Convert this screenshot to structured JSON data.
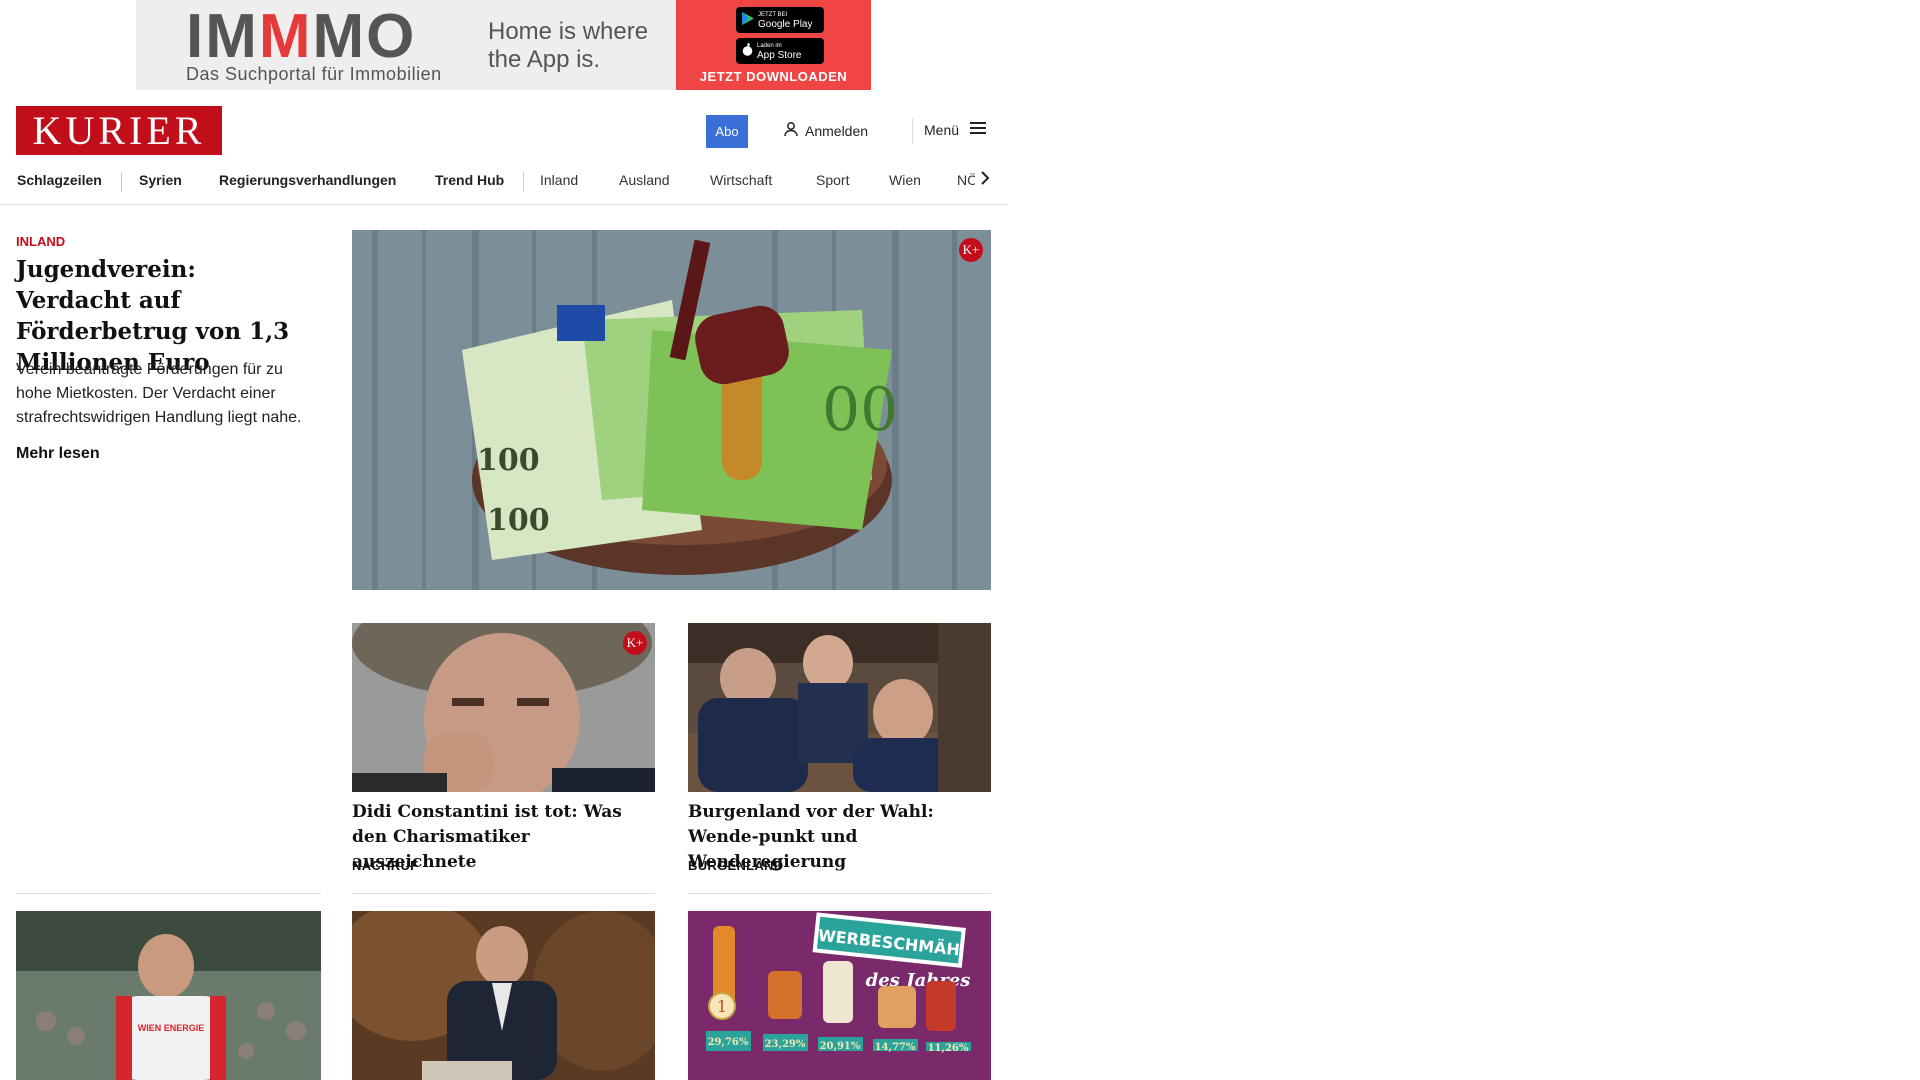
{
  "ad": {
    "brand_a": "IM",
    "brand_b": "M",
    "brand_c": "MO",
    "subtitle": "Das Suchportal für Immobilien",
    "slogan_line1": "Home is where",
    "slogan_line2": "the App is.",
    "google_play_small": "JETZT BEI",
    "google_play": "Google Play",
    "app_store_small": "Laden im",
    "app_store": "App Store",
    "cta": "JETZT DOWNLOADEN",
    "accent_color": "#f04545"
  },
  "header": {
    "logo": "KURIER",
    "abo": "Abo",
    "login": "Anmelden",
    "menu": "Menü",
    "brand_color": "#c20e1a",
    "abo_color": "#3a6fd8"
  },
  "nav": {
    "items": [
      "Schlagzeilen",
      "Syrien",
      "Regierungsverhandlungen",
      "Trend Hub",
      "Inland",
      "Ausland",
      "Wirtschaft",
      "Sport",
      "Wien",
      "NÖ"
    ]
  },
  "lead": {
    "kicker": "INLAND",
    "title": "Jugendverein: Verdacht auf Förderbetrug von 1,3 Millionen Euro",
    "teaser": "Verein beantragte Förderungen für zu hohe Mietkosten. Der Verdacht einer strafrechtswidrigen Handlung liegt nahe.",
    "more": "Mehr lesen",
    "badge": "K+"
  },
  "teasers": [
    {
      "title": "Didi Constantini ist tot: Was den Charismatiker auszeichnete",
      "kicker": "NACHRUF",
      "badge": "K+"
    },
    {
      "title": "Burgenland vor der Wahl: Wende-punkt und Wenderegierung",
      "kicker": "BURGENLAND"
    }
  ],
  "bottom_row": {
    "promo_headline1": "WERBESCHMÄH",
    "promo_headline2": "des Jahres",
    "percents": [
      "29,76%",
      "23,29%",
      "20,91%",
      "14,77%",
      "11,26%"
    ],
    "rank": "1",
    "jersey_text": "WIEN ENERGIE"
  }
}
